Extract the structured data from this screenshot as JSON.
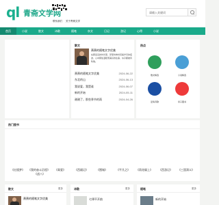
{
  "header": {
    "logo_mark": "ql",
    "site_name": "青斋文学网",
    "links": [
      "联系我们",
      "关于青斋文学"
    ],
    "search_placeholder": "请输入关键词"
  },
  "nav": {
    "items": [
      "首页",
      "小说",
      "散文",
      "诗歌",
      "随笔",
      "杂文",
      "日记",
      "游记",
      "心得",
      "小说"
    ],
    "active_index": 0
  },
  "featured": {
    "heading": "散文",
    "title": "萧萧的随笔文字优美",
    "summary": "在那遥远的时光里，梦里仿佛寻觅着岁月的痕迹，心中那些温暖而美好的往事，似乎都被风吹散。",
    "articles": [
      {
        "title": "萧萧的随笔文字优美",
        "date": "2024-06-22"
      },
      {
        "title": "东北的山",
        "date": "2024-06-13"
      },
      {
        "title": "我说爱，我是谁",
        "date": "2024-06-07"
      },
      {
        "title": "新的开始",
        "date": "2024-05-11"
      },
      {
        "title": "谢谢了，那些季节的雨",
        "date": "2024-04-26"
      }
    ]
  },
  "sidebar": {
    "heading": "热点",
    "items": [
      "散文精选",
      "小说精选",
      "爱情诗歌",
      "亲子图书"
    ],
    "colors": [
      "#2f9f5c",
      "#4a9fd6",
      "#1b4fa3",
      "#ee3a3a"
    ]
  },
  "hot_books": {
    "heading": "热门图书",
    "books": [
      "《红楼梦》",
      "《我的奋斗历程》",
      "《青瓷》",
      "《西厢记》",
      "《围城》",
      "《平凡之》",
      "《雨花碟上》",
      "《西游记》",
      "《三国演义》",
      "《战八》"
    ]
  },
  "bottom": {
    "panel_a": {
      "heading": "散文",
      "more": "更多",
      "title": "萧萧的随笔文字优美"
    },
    "panel_b": {
      "heading": "诗歌",
      "more": "更多",
      "title": "七律不开韵"
    },
    "panel_c": {
      "heading": "随笔",
      "more": "更多",
      "title": "新的开始"
    }
  }
}
